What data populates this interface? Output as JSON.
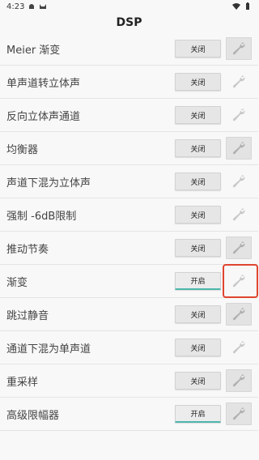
{
  "status_bar": {
    "time": "4:23",
    "icons": [
      "android-icon",
      "cat-icon",
      "wifi-icon",
      "battery-icon"
    ]
  },
  "header": {
    "title": "DSP"
  },
  "rows": [
    {
      "label": "Meier 渐变",
      "button": "关闭",
      "state": "off",
      "wrench": "enabled"
    },
    {
      "label": "单声道转立体声",
      "button": "关闭",
      "state": "off",
      "wrench": "disabled"
    },
    {
      "label": "反向立体声通道",
      "button": "关闭",
      "state": "off",
      "wrench": "disabled"
    },
    {
      "label": "均衡器",
      "button": "关闭",
      "state": "off",
      "wrench": "enabled"
    },
    {
      "label": "声道下混为立体声",
      "button": "关闭",
      "state": "off",
      "wrench": "disabled"
    },
    {
      "label": "强制 -6dB限制",
      "button": "关闭",
      "state": "off",
      "wrench": "disabled"
    },
    {
      "label": "推动节奏",
      "button": "关闭",
      "state": "off",
      "wrench": "enabled"
    },
    {
      "label": "渐变",
      "button": "开启",
      "state": "on",
      "wrench": "disabled"
    },
    {
      "label": "跳过静音",
      "button": "关闭",
      "state": "off",
      "wrench": "enabled"
    },
    {
      "label": "通道下混为单声道",
      "button": "关闭",
      "state": "off",
      "wrench": "disabled"
    },
    {
      "label": "重采样",
      "button": "关闭",
      "state": "off",
      "wrench": "enabled"
    },
    {
      "label": "高级限幅器",
      "button": "开启",
      "state": "on",
      "wrench": "enabled"
    }
  ],
  "colors": {
    "accent": "#4db6ac",
    "highlight": "#e0452f",
    "background": "#f8f8f8"
  }
}
